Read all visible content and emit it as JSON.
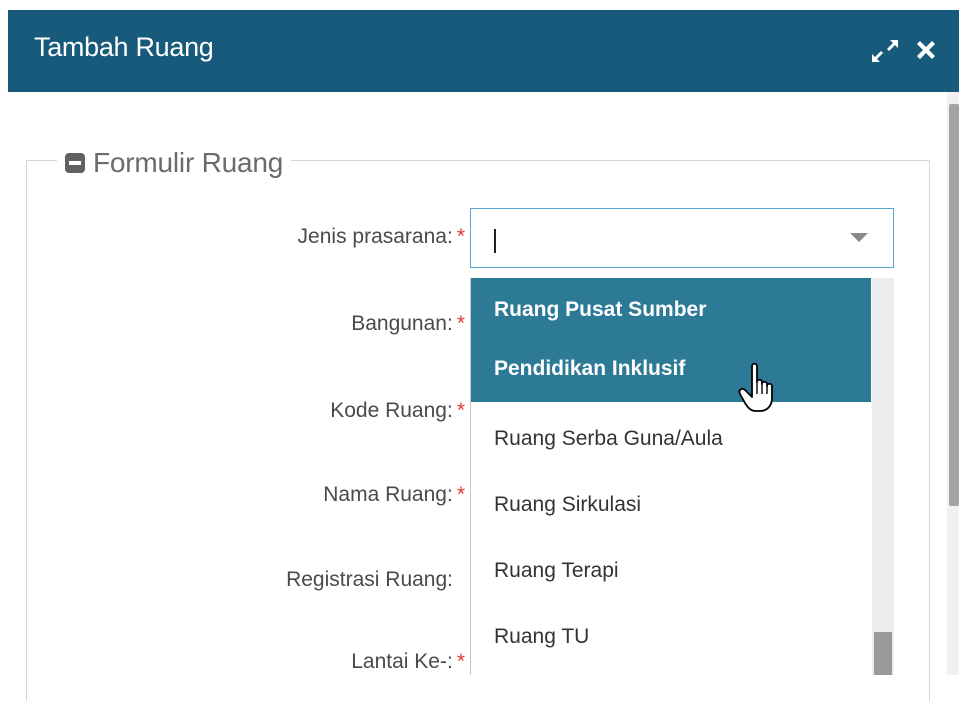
{
  "window": {
    "title": "Tambah Ruang",
    "maximize_icon": "expand-icon",
    "close_icon": "close-icon"
  },
  "form": {
    "legend": "Formulir Ruang",
    "legend_icon": "collapse-icon",
    "fields": [
      {
        "label": "Jenis prasarana:",
        "required": "*"
      },
      {
        "label": "Bangunan:",
        "required": "*"
      },
      {
        "label": "Kode Ruang:",
        "required": "*"
      },
      {
        "label": "Nama Ruang:",
        "required": "*"
      },
      {
        "label": "Registrasi Ruang:",
        "required": ""
      },
      {
        "label": "Lantai Ke-:",
        "required": "*"
      }
    ],
    "jenis_prasarana_value": ""
  },
  "dropdown": {
    "options": [
      {
        "label": "Ruang Pusat Sumber",
        "label2": "Pendidikan Inklusif",
        "highlighted": true
      },
      {
        "label": "Ruang Serba Guna/Aula",
        "highlighted": false
      },
      {
        "label": "Ruang Sirkulasi",
        "highlighted": false
      },
      {
        "label": "Ruang Terapi",
        "highlighted": false
      },
      {
        "label": "Ruang TU",
        "highlighted": false
      }
    ]
  },
  "colors": {
    "titlebar": "#175a7b",
    "highlight": "#2d7a97",
    "required": "#e53935",
    "focus_border": "#5aa5d2"
  }
}
